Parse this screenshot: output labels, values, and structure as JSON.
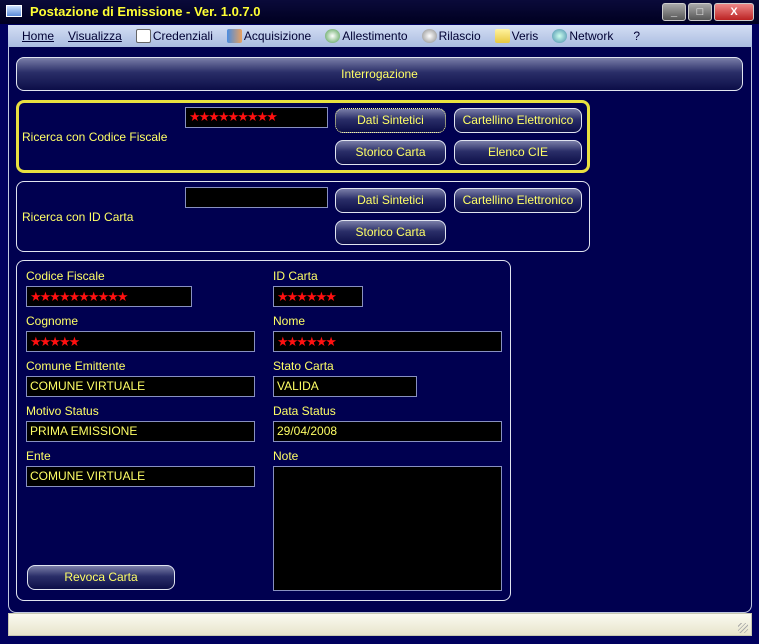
{
  "window": {
    "title": "Postazione di Emissione - Ver. 1.0.7.0",
    "minimize": "_",
    "maximize": "□",
    "close": "X"
  },
  "menu": [
    {
      "label": "Home",
      "icon": "none"
    },
    {
      "label": "Visualizza",
      "icon": "none"
    },
    {
      "label": "Credenziali",
      "icon": "certificate-icon"
    },
    {
      "label": "Acquisizione",
      "icon": "people-icon"
    },
    {
      "label": "Allestimento",
      "icon": "disc-gear-icon"
    },
    {
      "label": "Rilascio",
      "icon": "hand-icon"
    },
    {
      "label": "Veris",
      "icon": "folder-icon"
    },
    {
      "label": "Network",
      "icon": "network-icon"
    },
    {
      "label": "?",
      "icon": "none"
    }
  ],
  "header": {
    "label": "Interrogazione"
  },
  "search_cf": {
    "label": "Ricerca con Codice Fiscale",
    "value": "★★★★★★★★★",
    "buttons": {
      "dati": "Dati Sintetici",
      "cartellino": "Cartellino Elettronico",
      "storico": "Storico Carta",
      "elenco": "Elenco CIE"
    }
  },
  "search_id": {
    "label": "Ricerca con ID Carta",
    "value": "",
    "buttons": {
      "dati": "Dati Sintetici",
      "cartellino": "Cartellino Elettronico",
      "storico": "Storico Carta"
    }
  },
  "details": {
    "codice_fiscale": {
      "label": "Codice Fiscale",
      "value": "★★★★★★★★★★"
    },
    "id_carta": {
      "label": "ID Carta",
      "value": "★★★★★★"
    },
    "cognome": {
      "label": "Cognome",
      "value": "★★★★★"
    },
    "nome": {
      "label": "Nome",
      "value": "★★★★★★"
    },
    "comune": {
      "label": "Comune Emittente",
      "value": "COMUNE VIRTUALE"
    },
    "stato": {
      "label": "Stato Carta",
      "value": "VALIDA"
    },
    "motivo": {
      "label": "Motivo Status",
      "value": "PRIMA EMISSIONE"
    },
    "data_status": {
      "label": "Data Status",
      "value": "29/04/2008"
    },
    "ente": {
      "label": "Ente",
      "value": "COMUNE VIRTUALE"
    },
    "note": {
      "label": "Note",
      "value": ""
    },
    "revoca": "Revoca Carta"
  },
  "colors": {
    "background": "#000050",
    "text": "#ffff66",
    "focus_border": "#e8e040",
    "redaction": "#ff1010"
  }
}
